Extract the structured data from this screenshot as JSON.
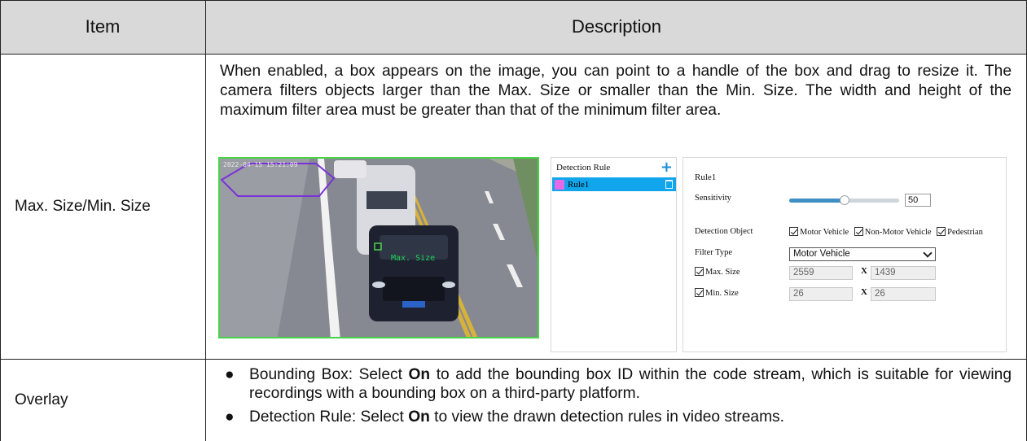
{
  "table": {
    "headers": {
      "item": "Item",
      "description": "Description"
    },
    "rows": [
      {
        "item": "Max. Size/Min. Size",
        "description": "When enabled, a box appears on the image, you can point to a handle of the box and drag to resize it. The camera filters objects larger than the Max. Size or smaller than the Min. Size. The width and height of the maximum filter area must be greater than that of the minimum filter area."
      },
      {
        "item": "Overlay",
        "bullets": [
          {
            "prefix": "Bounding Box: Select ",
            "bold": "On",
            "suffix": " to add the bounding box ID within the code stream, which is suitable for viewing recordings with a bounding box on a third-party platform."
          },
          {
            "prefix": "Detection Rule: Select ",
            "bold": "On",
            "suffix": " to view the drawn detection rules in video streams."
          }
        ]
      }
    ]
  },
  "camera_view": {
    "timestamp": "2022-04-15 15:21:09",
    "overlay_label": "Max. Size",
    "box_color": "#49d34a",
    "region_color": "#7a33d9"
  },
  "rule_panel": {
    "title": "Detection Rule",
    "add_icon": "plus-icon",
    "selected_rule": "Rule1",
    "selected_color": "#11a6ec",
    "swatch_color": "#e56ae8"
  },
  "settings_panel": {
    "rule_name": "Rule1",
    "sensitivity_label": "Sensitivity",
    "sensitivity_value": "50",
    "sensitivity_fraction": 0.5,
    "detection_object_label": "Detection Object",
    "objects": [
      "Motor Vehicle",
      "Non-Motor Vehicle",
      "Pedestrian"
    ],
    "filter_type_label": "Filter Type",
    "filter_type_value": "Motor Vehicle",
    "max_size_label": "Max. Size",
    "max_width": "2559",
    "max_height": "1439",
    "min_size_label": "Min. Size",
    "min_width": "26",
    "min_height": "26",
    "separator": "X"
  }
}
